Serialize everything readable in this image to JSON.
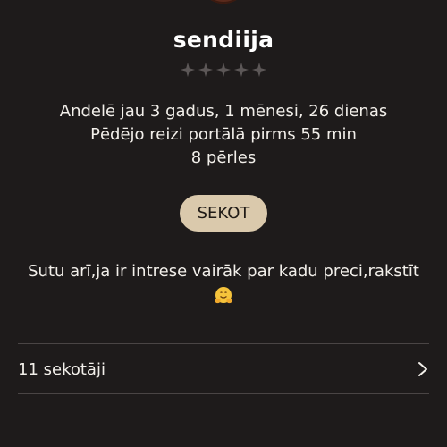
{
  "profile": {
    "username": "sendiija",
    "rating": {
      "filled": 0,
      "total": 5,
      "empty_color": "#5c5757"
    },
    "info": {
      "member_since": "Andelē jau 3 gadus, 1 mēnesi, 26 dienas",
      "last_seen": "Pēdējo reizi portālā pirms 55 min",
      "pearls": "8 pērles"
    },
    "follow_label": "SEKOT",
    "bio_line1": "Sutu arī,ja ir intrese vairāk par kadu preci,rakstīt",
    "bio_emoji": "hugging-face-icon"
  },
  "followers": {
    "label": "11 sekotāji"
  },
  "colors": {
    "background": "#1e1b1b",
    "follow_button": "#dac9ac",
    "divider": "#4a4545",
    "text": "#f2efea"
  }
}
